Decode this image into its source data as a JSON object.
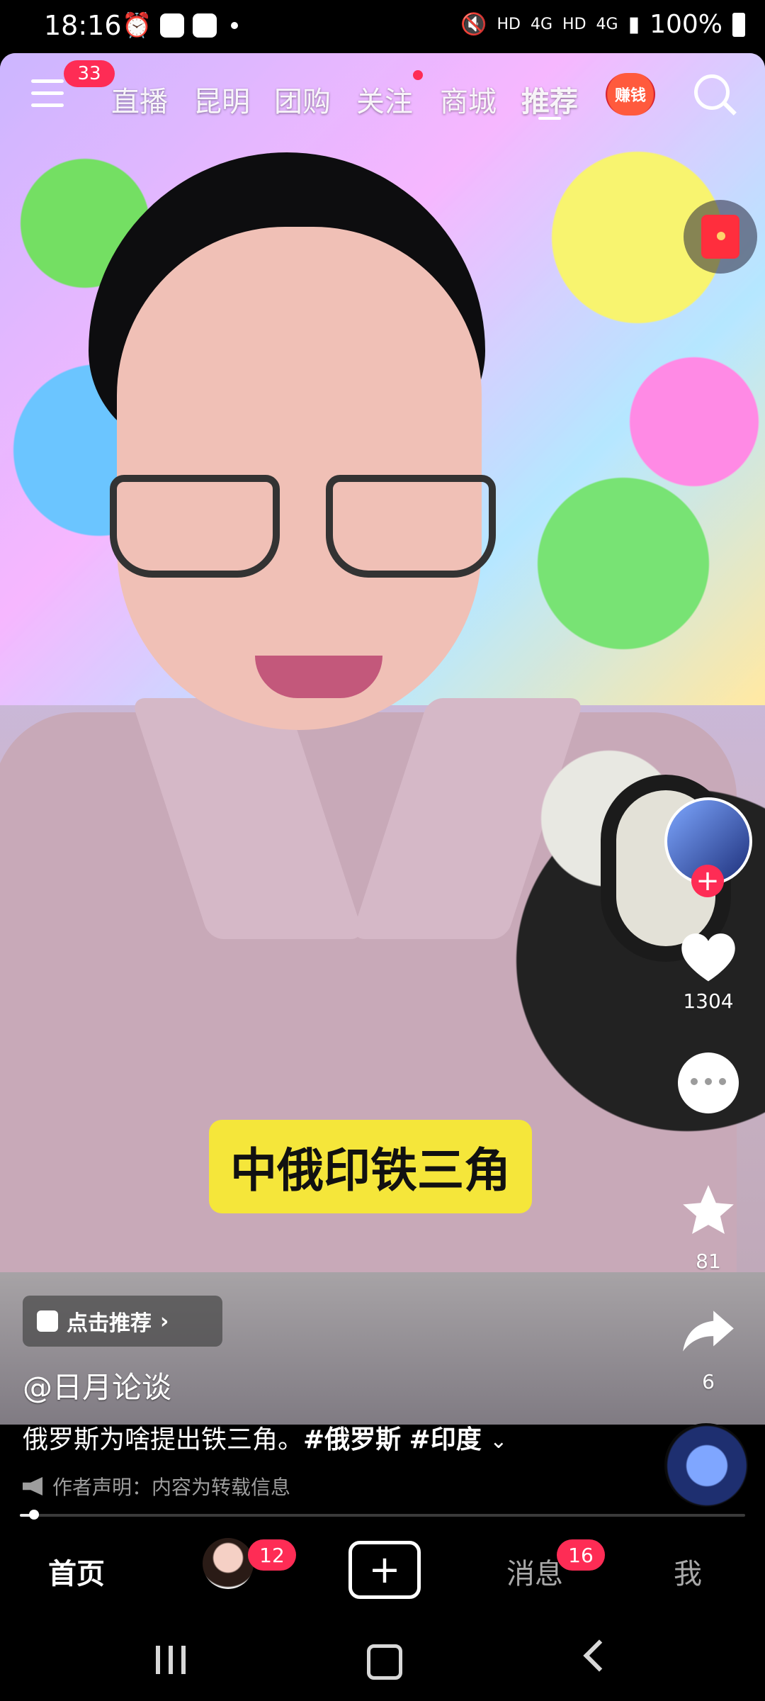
{
  "status_bar": {
    "time": "18:16",
    "network_hd1": "HD",
    "network_4g1": "4G",
    "network_hd2": "HD",
    "network_4g2": "4G",
    "battery": "100%"
  },
  "top_nav": {
    "menu_badge": "33",
    "tabs": [
      {
        "label": "直播"
      },
      {
        "label": "昆明"
      },
      {
        "label": "团购"
      },
      {
        "label": "关注"
      },
      {
        "label": "商城"
      },
      {
        "label": "推荐"
      }
    ],
    "earn_label": "赚钱"
  },
  "video": {
    "caption": "中俄印铁三角"
  },
  "actions": {
    "like_count": "1304",
    "favorite_count": "81",
    "share_count": "6"
  },
  "bottom_info": {
    "recommend_label": "点击推荐",
    "username": "@日月论谈",
    "description_text": "俄罗斯为啥提出铁三角。",
    "tag1": "#俄罗斯",
    "tag2": "#印度",
    "declaration": "作者声明：内容为转载信息",
    "progress": 0.02
  },
  "tabbar": {
    "home_label": "首页",
    "friend_badge": "12",
    "messages_label": "消息",
    "messages_badge": "16",
    "me_label": "我"
  },
  "colors": {
    "accent": "#fe2c55",
    "caption_bg": "#f5e63a"
  }
}
